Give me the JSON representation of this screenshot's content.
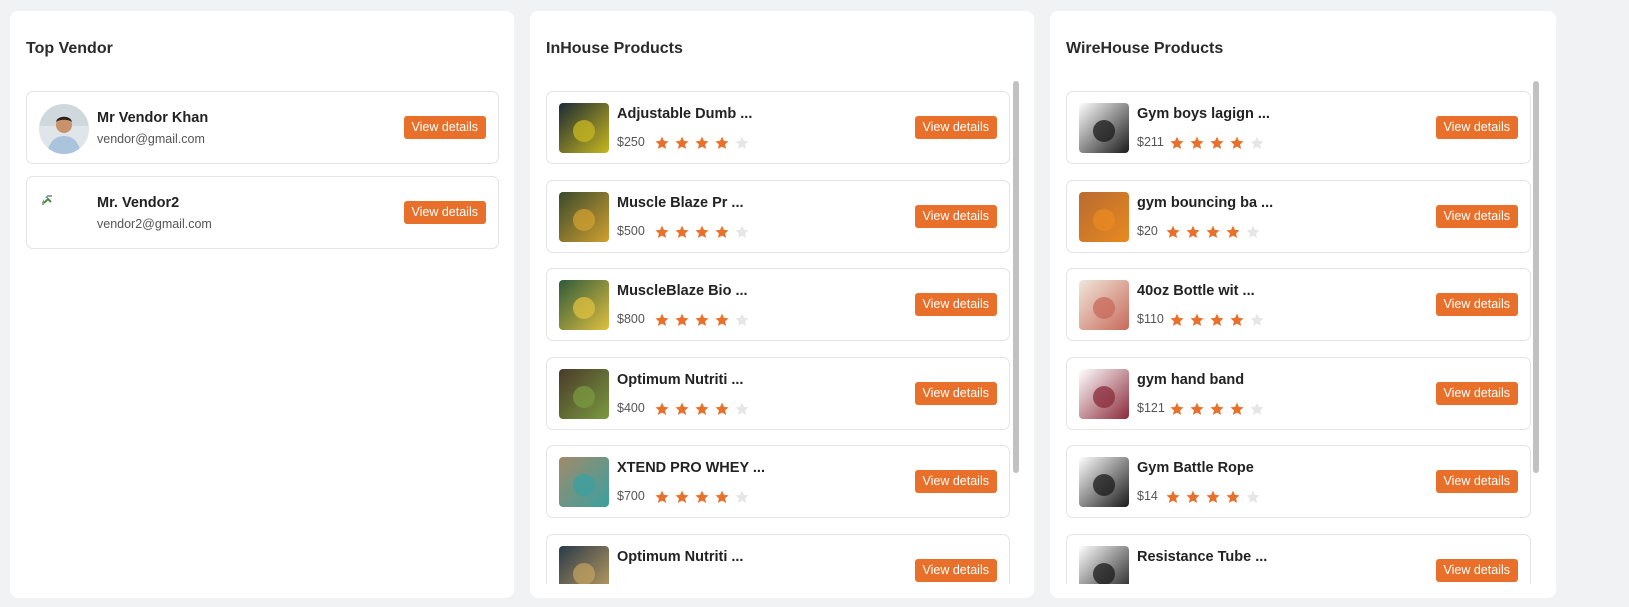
{
  "colors": {
    "accent": "#e8702a",
    "star_empty": "#e6e6e6",
    "page_bg": "#f1f2f4"
  },
  "top_vendor": {
    "title": "Top Vendor",
    "vendors": [
      {
        "name": "Mr Vendor Khan",
        "email": "vendor@gmail.com",
        "button": "View details",
        "avatar": "person-photo"
      },
      {
        "name": "Mr. Vendor2",
        "email": "vendor2@gmail.com",
        "button": "View details",
        "avatar": "broken-image-icon"
      }
    ]
  },
  "inhouse": {
    "title": "InHouse Products",
    "products": [
      {
        "name": "Adjustable Dumb ...",
        "price": "$250",
        "rating": 4,
        "button": "View details",
        "thumb_colors": [
          "#1c2a33",
          "#c8b820"
        ]
      },
      {
        "name": "Muscle Blaze Pr ...",
        "price": "$500",
        "rating": 4,
        "button": "View details",
        "thumb_colors": [
          "#3a4a2c",
          "#d0a030"
        ]
      },
      {
        "name": "MuscleBlaze Bio ...",
        "price": "$800",
        "rating": 4,
        "button": "View details",
        "thumb_colors": [
          "#2f5a3a",
          "#e0c040"
        ]
      },
      {
        "name": "Optimum Nutriti ...",
        "price": "$400",
        "rating": 4,
        "button": "View details",
        "thumb_colors": [
          "#4a3a2a",
          "#7a9a40"
        ]
      },
      {
        "name": "XTEND PRO WHEY ...",
        "price": "$700",
        "rating": 4,
        "button": "View details",
        "thumb_colors": [
          "#a08a6a",
          "#3aa0a0"
        ]
      },
      {
        "name": "Optimum Nutriti ...",
        "price": "",
        "rating": 0,
        "button": "View details",
        "thumb_colors": [
          "#2a3a4a",
          "#c0a060"
        ]
      }
    ]
  },
  "wirehouse": {
    "title": "WireHouse Products",
    "products": [
      {
        "name": "Gym boys lagign ...",
        "price": "$211",
        "rating": 4,
        "button": "View details",
        "thumb_colors": [
          "#ffffff",
          "#1a1a1a"
        ]
      },
      {
        "name": "gym bouncing ba ...",
        "price": "$20",
        "rating": 4,
        "button": "View details",
        "thumb_colors": [
          "#b86a30",
          "#e88a20"
        ]
      },
      {
        "name": "40oz Bottle wit ...",
        "price": "$110",
        "rating": 4,
        "button": "View details",
        "thumb_colors": [
          "#f0e6da",
          "#c86a5a"
        ]
      },
      {
        "name": "gym hand band",
        "price": "$121",
        "rating": 4,
        "button": "View details",
        "thumb_colors": [
          "#ffffff",
          "#8a2a3a"
        ]
      },
      {
        "name": "Gym Battle Rope",
        "price": "$14",
        "rating": 4,
        "button": "View details",
        "thumb_colors": [
          "#ffffff",
          "#1a1a1a"
        ]
      },
      {
        "name": "Resistance Tube ...",
        "price": "",
        "rating": 0,
        "button": "View details",
        "thumb_colors": [
          "#ffffff",
          "#1a1a1a"
        ]
      }
    ]
  }
}
